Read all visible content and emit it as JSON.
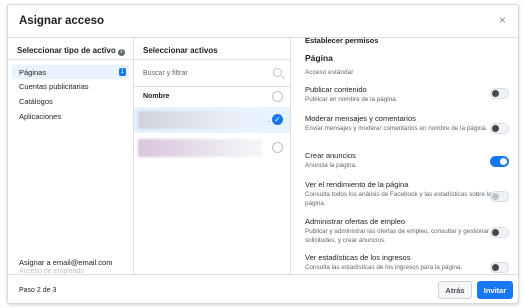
{
  "dialog": {
    "title": "Asignar acceso",
    "close_icon": "×"
  },
  "asset_types": {
    "header": "Seleccionar tipo de activo",
    "items": [
      {
        "label": "Páginas",
        "count": "1"
      },
      {
        "label": "Cuentas publicitarias"
      },
      {
        "label": "Catálogos"
      },
      {
        "label": "Aplicaciones"
      }
    ],
    "assign_to": "Asignar a email@email.com",
    "employee_access": "Acceso de empleado"
  },
  "assets": {
    "header": "Seleccionar activos",
    "search_placeholder": "Buscar y filtrar",
    "name_label": "Nombre",
    "rows": [
      {
        "suffix": ".",
        "selected": true
      },
      {
        "suffix": "",
        "selected": false
      }
    ]
  },
  "permissions": {
    "header": "Establecer permisos",
    "section": "Página",
    "subsection": "Acceso estándar",
    "items": [
      {
        "title": "Publicar contenido",
        "desc": "Publicar en nombre de la página.",
        "state": "off"
      },
      {
        "title": "Moderar mensajes y comentarios",
        "desc": "Enviar mensajes y moderar comentarios en nombre de la página.",
        "state": "off"
      },
      {
        "title": "Crear anuncios",
        "desc": "Anuncia la página.",
        "state": "on"
      },
      {
        "title": "Ver el rendimiento de la página",
        "desc": "Consulta todos los análisis de Facebook y las estadísticas sobre la página.",
        "state": "disabled"
      },
      {
        "title": "Administrar ofertas de empleo",
        "desc": "Publicar y administrar las ofertas de empleo, consultar y gestionar las solicitudes, y crear anuncios.",
        "state": "off"
      },
      {
        "title": "Ver estadísticas de los ingresos",
        "desc": "Consulta las estadísticas de los ingresos para la página.",
        "state": "off"
      }
    ]
  },
  "footer": {
    "step": "Paso 2 de 3",
    "back_label": "Atrás",
    "next_label": "Invitar"
  },
  "colors": {
    "accent": "#1877f2",
    "selected_bg": "#e7f3ff"
  }
}
